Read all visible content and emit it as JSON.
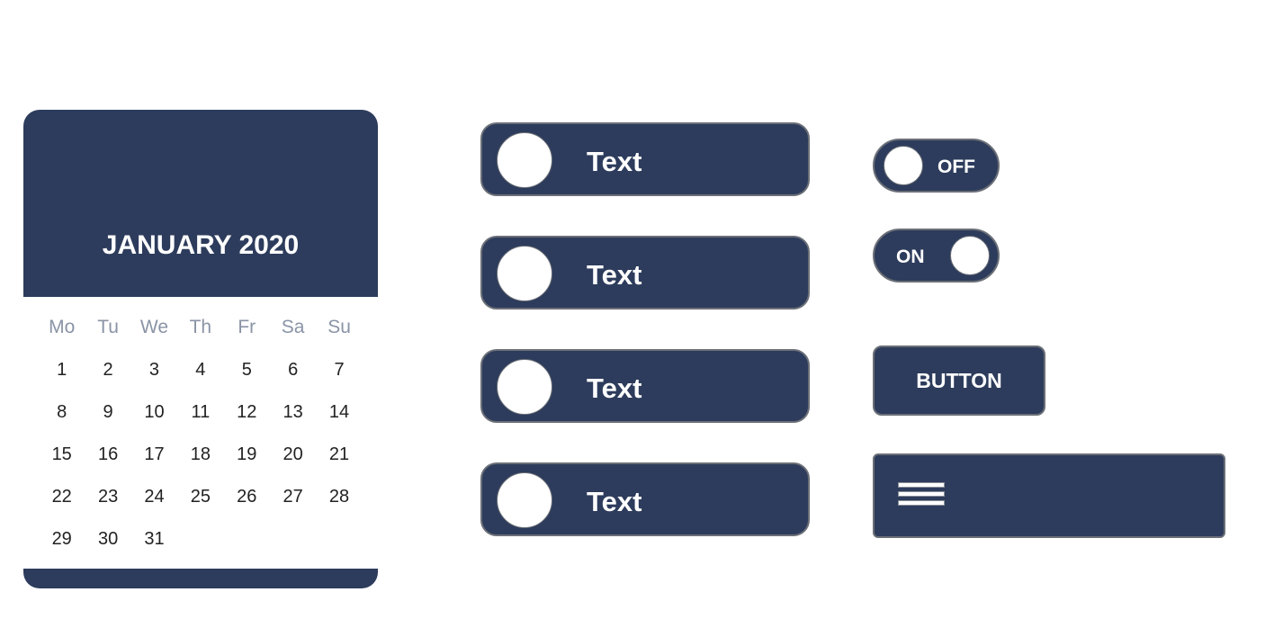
{
  "calendar": {
    "title": "JANUARY 2020",
    "weekdays": [
      "Mo",
      "Tu",
      "We",
      "Th",
      "Fr",
      "Sa",
      "Su"
    ],
    "weeks": [
      [
        "1",
        "2",
        "3",
        "4",
        "5",
        "6",
        "7"
      ],
      [
        "8",
        "9",
        "10",
        "11",
        "12",
        "13",
        "14"
      ],
      [
        "15",
        "16",
        "17",
        "18",
        "19",
        "20",
        "21"
      ],
      [
        "22",
        "23",
        "24",
        "25",
        "26",
        "27",
        "28"
      ],
      [
        "29",
        "30",
        "31",
        "",
        "",
        "",
        ""
      ]
    ]
  },
  "pills": [
    {
      "label": "Text"
    },
    {
      "label": "Text"
    },
    {
      "label": "Text"
    },
    {
      "label": "Text"
    }
  ],
  "toggles": {
    "off_label": "OFF",
    "on_label": "ON"
  },
  "button": {
    "label": "BUTTON"
  },
  "colors": {
    "navy": "#2d3c5c",
    "border": "#6b6f77",
    "weekday_text": "#8a94a6"
  },
  "icons": {
    "menu": "hamburger-menu-icon"
  }
}
